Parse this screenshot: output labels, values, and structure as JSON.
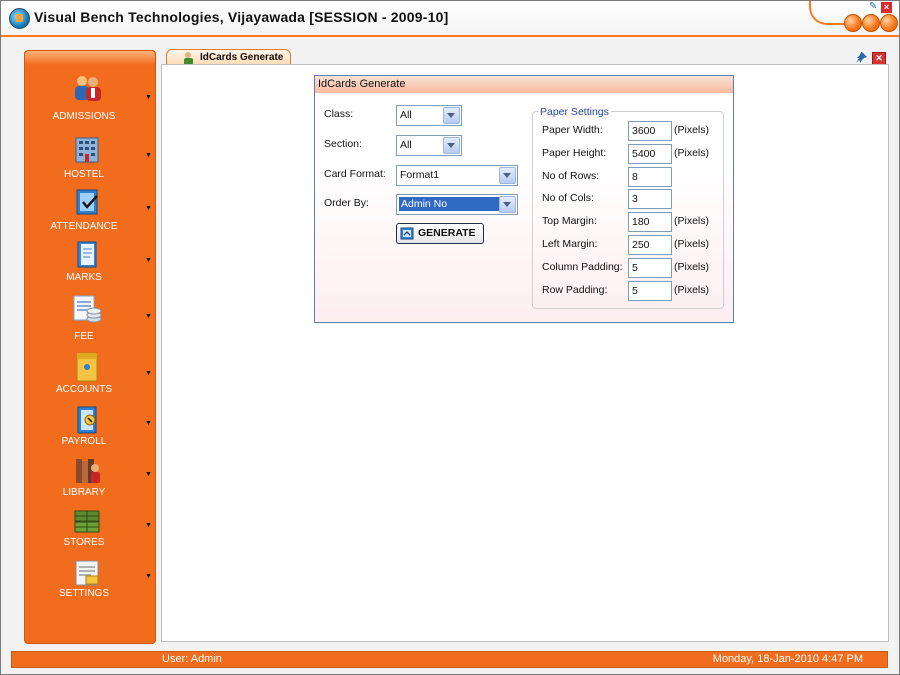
{
  "window": {
    "title": "Visual Bench Technologies, Vijayawada [SESSION - 2009-10]"
  },
  "sidebar": {
    "items": [
      {
        "label": "ADMISSIONS",
        "icon": "admissions-icon"
      },
      {
        "label": "HOSTEL",
        "icon": "hostel-icon"
      },
      {
        "label": "ATTENDANCE",
        "icon": "attendance-icon"
      },
      {
        "label": "MARKS",
        "icon": "marks-icon"
      },
      {
        "label": "FEE",
        "icon": "fee-icon"
      },
      {
        "label": "ACCOUNTS",
        "icon": "accounts-icon"
      },
      {
        "label": "PAYROLL",
        "icon": "payroll-icon"
      },
      {
        "label": "LIBRARY",
        "icon": "library-icon"
      },
      {
        "label": "STORES",
        "icon": "stores-icon"
      },
      {
        "label": "SETTINGS",
        "icon": "settings-icon"
      }
    ]
  },
  "tab": {
    "label": "IdCards Generate"
  },
  "panel": {
    "title": "IdCards Generate",
    "class_label": "Class:",
    "class_value": "All",
    "section_label": "Section:",
    "section_value": "All",
    "card_format_label": "Card Format:",
    "card_format_value": "Format1",
    "order_by_label": "Order By:",
    "order_by_value": "Admin No",
    "generate_label": "GENERATE"
  },
  "paper_settings": {
    "legend": "Paper Settings",
    "rows": [
      {
        "label": "Paper Width:",
        "value": "3600",
        "unit": "(Pixels)"
      },
      {
        "label": "Paper Height:",
        "value": "5400",
        "unit": "(Pixels)"
      },
      {
        "label": "No of Rows:",
        "value": "8",
        "unit": ""
      },
      {
        "label": "No of Cols:",
        "value": "3",
        "unit": ""
      },
      {
        "label": "Top Margin:",
        "value": "180",
        "unit": "(Pixels)"
      },
      {
        "label": "Left Margin:",
        "value": "250",
        "unit": "(Pixels)"
      },
      {
        "label": "Column Padding:",
        "value": "5",
        "unit": "(Pixels)"
      },
      {
        "label": "Row Padding:",
        "value": "5",
        "unit": "(Pixels)"
      }
    ]
  },
  "status": {
    "user": "User: Admin",
    "datetime": "Monday, 18-Jan-2010 4:47 PM"
  },
  "colors": {
    "accent": "#f26c1e",
    "panel_border": "#5b7fb5",
    "selection": "#316ac5"
  }
}
